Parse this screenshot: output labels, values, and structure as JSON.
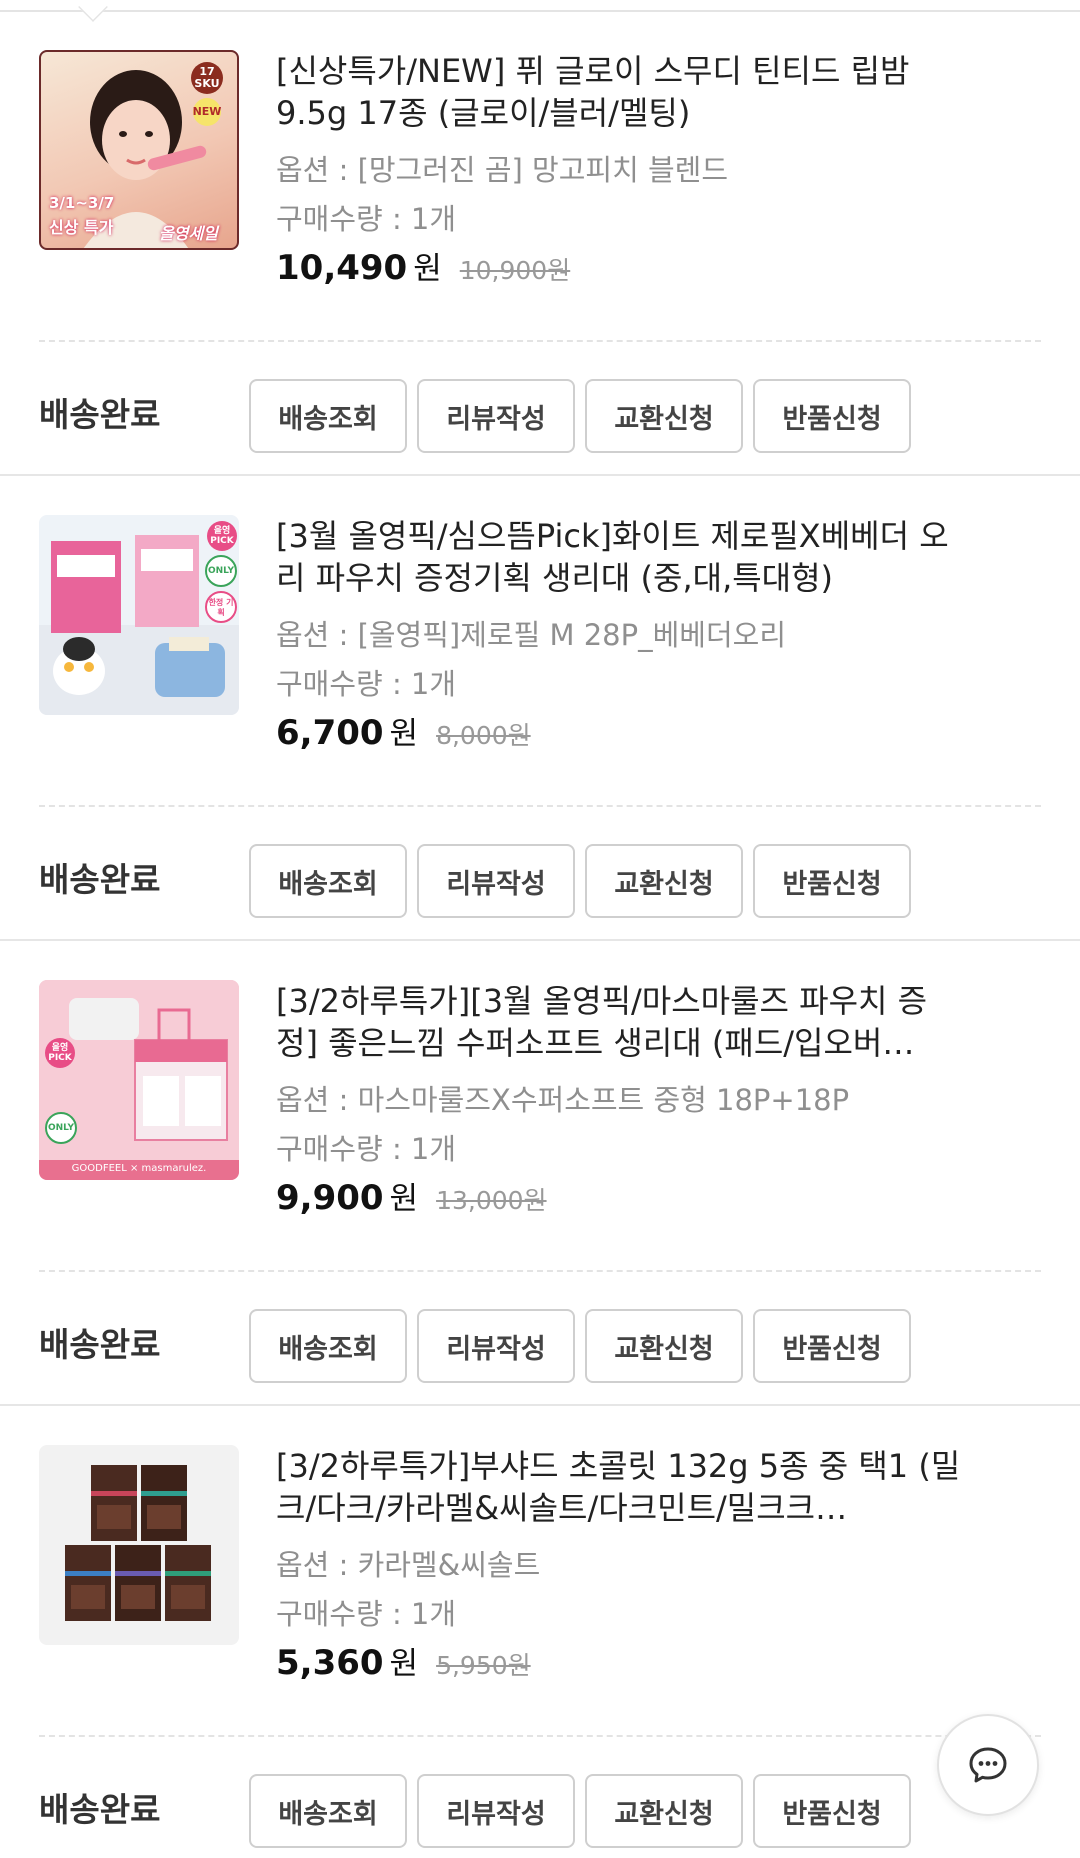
{
  "orders": [
    {
      "title": "[신상특가/NEW] 퓌 글로이 스무디 틴티드 립밤 9.5g 17종 (글로이/블러/멜팅)",
      "option": "옵션 : [망그러진 곰] 망고피치 블렌드",
      "quantity": "구매수량 : 1개",
      "price": "10,490",
      "currency": "원",
      "original_price": "10,900원",
      "status": "배송완료",
      "thumb": {
        "badge1": "17\nSKU",
        "badge2": "NEW",
        "caption1": "3/1~3/7",
        "caption2": "신상 특가",
        "caption3": "올영세일"
      }
    },
    {
      "title": "[3월 올영픽/심으뜸Pick]화이트 제로필X베베더 오리 파우치 증정기획 생리대 (중,대,특대형)",
      "option": "옵션 : [올영픽]제로필 M 28P_베베더오리",
      "quantity": "구매수량 : 1개",
      "price": "6,700",
      "currency": "원",
      "original_price": "8,000원",
      "status": "배송완료",
      "thumb": {
        "badge1": "올영 PICK",
        "badge2": "ONLY",
        "badge3": "한정 기획"
      }
    },
    {
      "title": "[3/2하루특가][3월 올영픽/마스마룰즈 파우치 증정] 좋은느낌 수퍼소프트 생리대 (패드/입오버…",
      "option": "옵션 : 마스마룰즈X수퍼소프트 중형 18P+18P",
      "quantity": "구매수량 : 1개",
      "price": "9,900",
      "currency": "원",
      "original_price": "13,000원",
      "status": "배송완료",
      "thumb": {
        "badge1": "올영 PICK",
        "badge2": "ONLY",
        "footer": "GOODFEEL × masmarulez."
      }
    },
    {
      "title": "[3/2하루특가]부샤드 초콜릿 132g 5종 중 택1 (밀크/다크/카라멜&씨솔트/다크민트/밀크크…",
      "option": "옵션 : 카라멜&씨솔트",
      "quantity": "구매수량 : 1개",
      "price": "5,360",
      "currency": "원",
      "original_price": "5,950원",
      "status": "배송완료",
      "thumb": {}
    }
  ],
  "buttons": {
    "track": "배송조회",
    "review": "리뷰작성",
    "exchange": "교환신청",
    "return": "반품신청"
  },
  "fab": {
    "icon": "chat-bubble-icon"
  }
}
